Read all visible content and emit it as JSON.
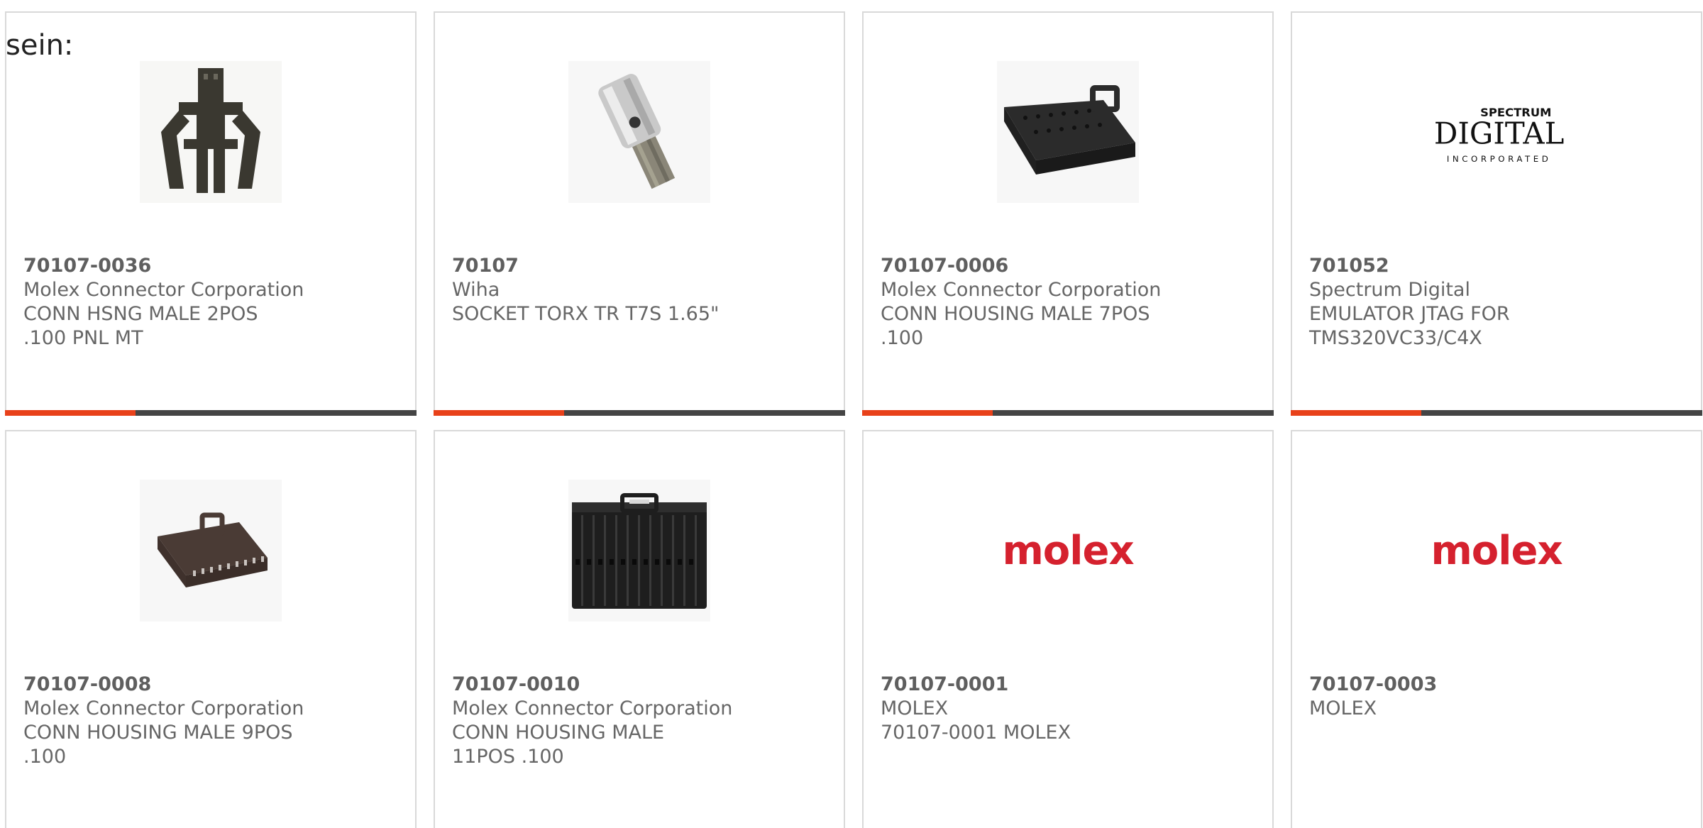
{
  "intro_text": "sein:",
  "colors": {
    "accent": "#e8411a",
    "bar": "#444444",
    "molex_red": "#d5212e"
  },
  "products": [
    {
      "part_number": "70107-0036",
      "manufacturer": "Molex Connector Corporation",
      "description": "CONN HSNG MALE 2POS .100 PNL MT",
      "image": "connector-housing-clip-image"
    },
    {
      "part_number": "70107",
      "manufacturer": "Wiha",
      "description": "SOCKET TORX TR T7S 1.65\"",
      "image": "torx-socket-bit-image"
    },
    {
      "part_number": "70107-0006",
      "manufacturer": "Molex Connector Corporation",
      "description": "CONN HOUSING MALE 7POS .100",
      "image": "connector-housing-7pos-image"
    },
    {
      "part_number": "701052",
      "manufacturer": "Spectrum Digital",
      "description": "EMULATOR JTAG FOR TMS320VC33/C4X",
      "image": "spectrum-digital-logo",
      "logo_text": {
        "top": "SPECTRUM",
        "main": "DIGITAL",
        "bottom": "INCORPORATED"
      }
    },
    {
      "part_number": "70107-0008",
      "manufacturer": "Molex Connector Corporation",
      "description": "CONN HOUSING MALE 9POS .100",
      "image": "connector-housing-9pos-image"
    },
    {
      "part_number": "70107-0010",
      "manufacturer": "Molex Connector Corporation",
      "description": "CONN HOUSING MALE 11POS .100",
      "image": "connector-housing-11pos-image"
    },
    {
      "part_number": "70107-0001",
      "manufacturer": "MOLEX",
      "description": "70107-0001 MOLEX",
      "image": "molex-logo",
      "logo_text": "molex"
    },
    {
      "part_number": "70107-0003",
      "manufacturer": "MOLEX",
      "description": "",
      "image": "molex-logo",
      "logo_text": "molex"
    }
  ]
}
